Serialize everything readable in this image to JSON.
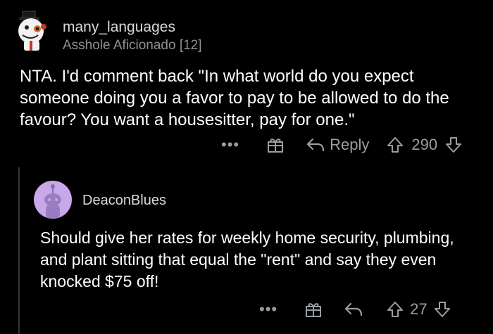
{
  "parent_comment": {
    "username": "many_languages",
    "flair": "Asshole Aficionado [12]",
    "avatar_icon": "snowman-avatar-icon",
    "body": "NTA. I'd comment back \"In what world do you expect someone doing you a favor to pay to be allowed to do the favour? You want a housesitter, pay for one.\"",
    "actions": {
      "more_label": "•••",
      "reply_label": "Reply",
      "score": "290"
    }
  },
  "reply_comment": {
    "username": "DeaconBlues",
    "avatar_icon": "reddit-alien-avatar-icon",
    "body": "Should give her rates for weekly home security, plumbing, and plant sitting that equal the \"rent\" and say they even knocked $75 off!",
    "actions": {
      "more_label": "•••",
      "score": "27"
    }
  },
  "colors": {
    "background": "#000000",
    "text": "#ffffff",
    "muted": "#9a9ea2",
    "avatar_bg": "#c8a8e8"
  }
}
